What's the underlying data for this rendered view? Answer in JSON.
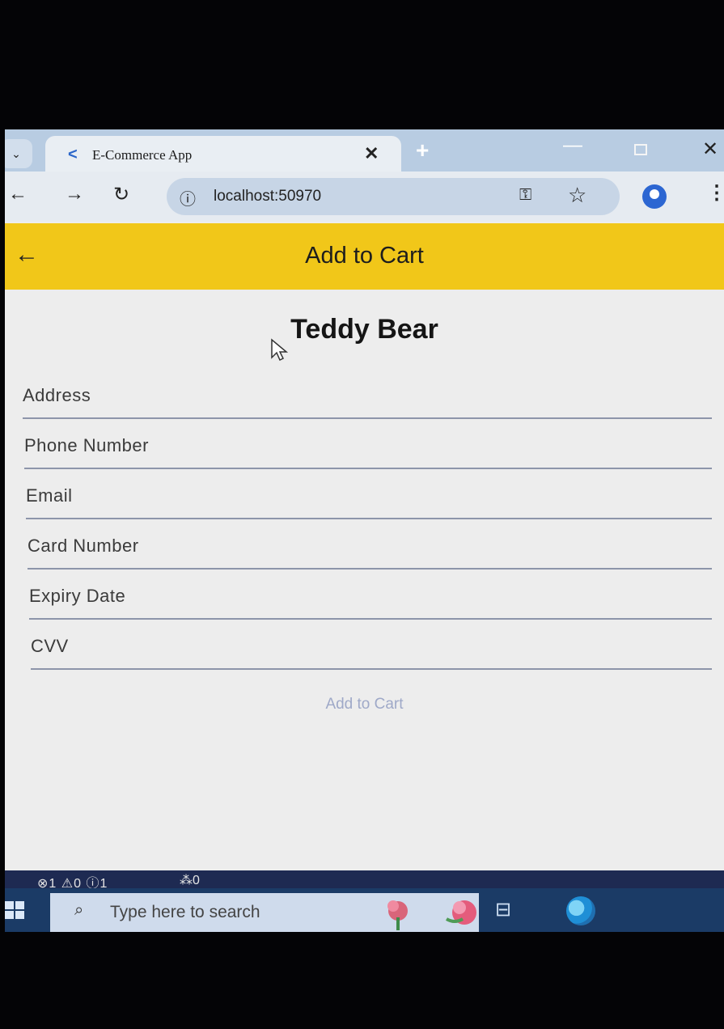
{
  "browser": {
    "tab_title": "E-Commerce App",
    "url": "localhost:50970"
  },
  "app": {
    "title": "Add to Cart",
    "product_name": "Teddy Bear",
    "fields": [
      {
        "label": "Address"
      },
      {
        "label": "Phone Number"
      },
      {
        "label": "Email"
      },
      {
        "label": "Card Number"
      },
      {
        "label": "Expiry Date"
      },
      {
        "label": "CVV"
      }
    ],
    "submit_label": "Add to Cart"
  },
  "status_bar": {
    "problems": "⊗1 ⚠0 ⓘ1",
    "remote": "⁂0"
  },
  "taskbar": {
    "search_placeholder": "Type here to search"
  },
  "colors": {
    "appbar": "#f1c719",
    "taskbar": "#1b3b66",
    "tabstrip": "#b8cce2"
  }
}
